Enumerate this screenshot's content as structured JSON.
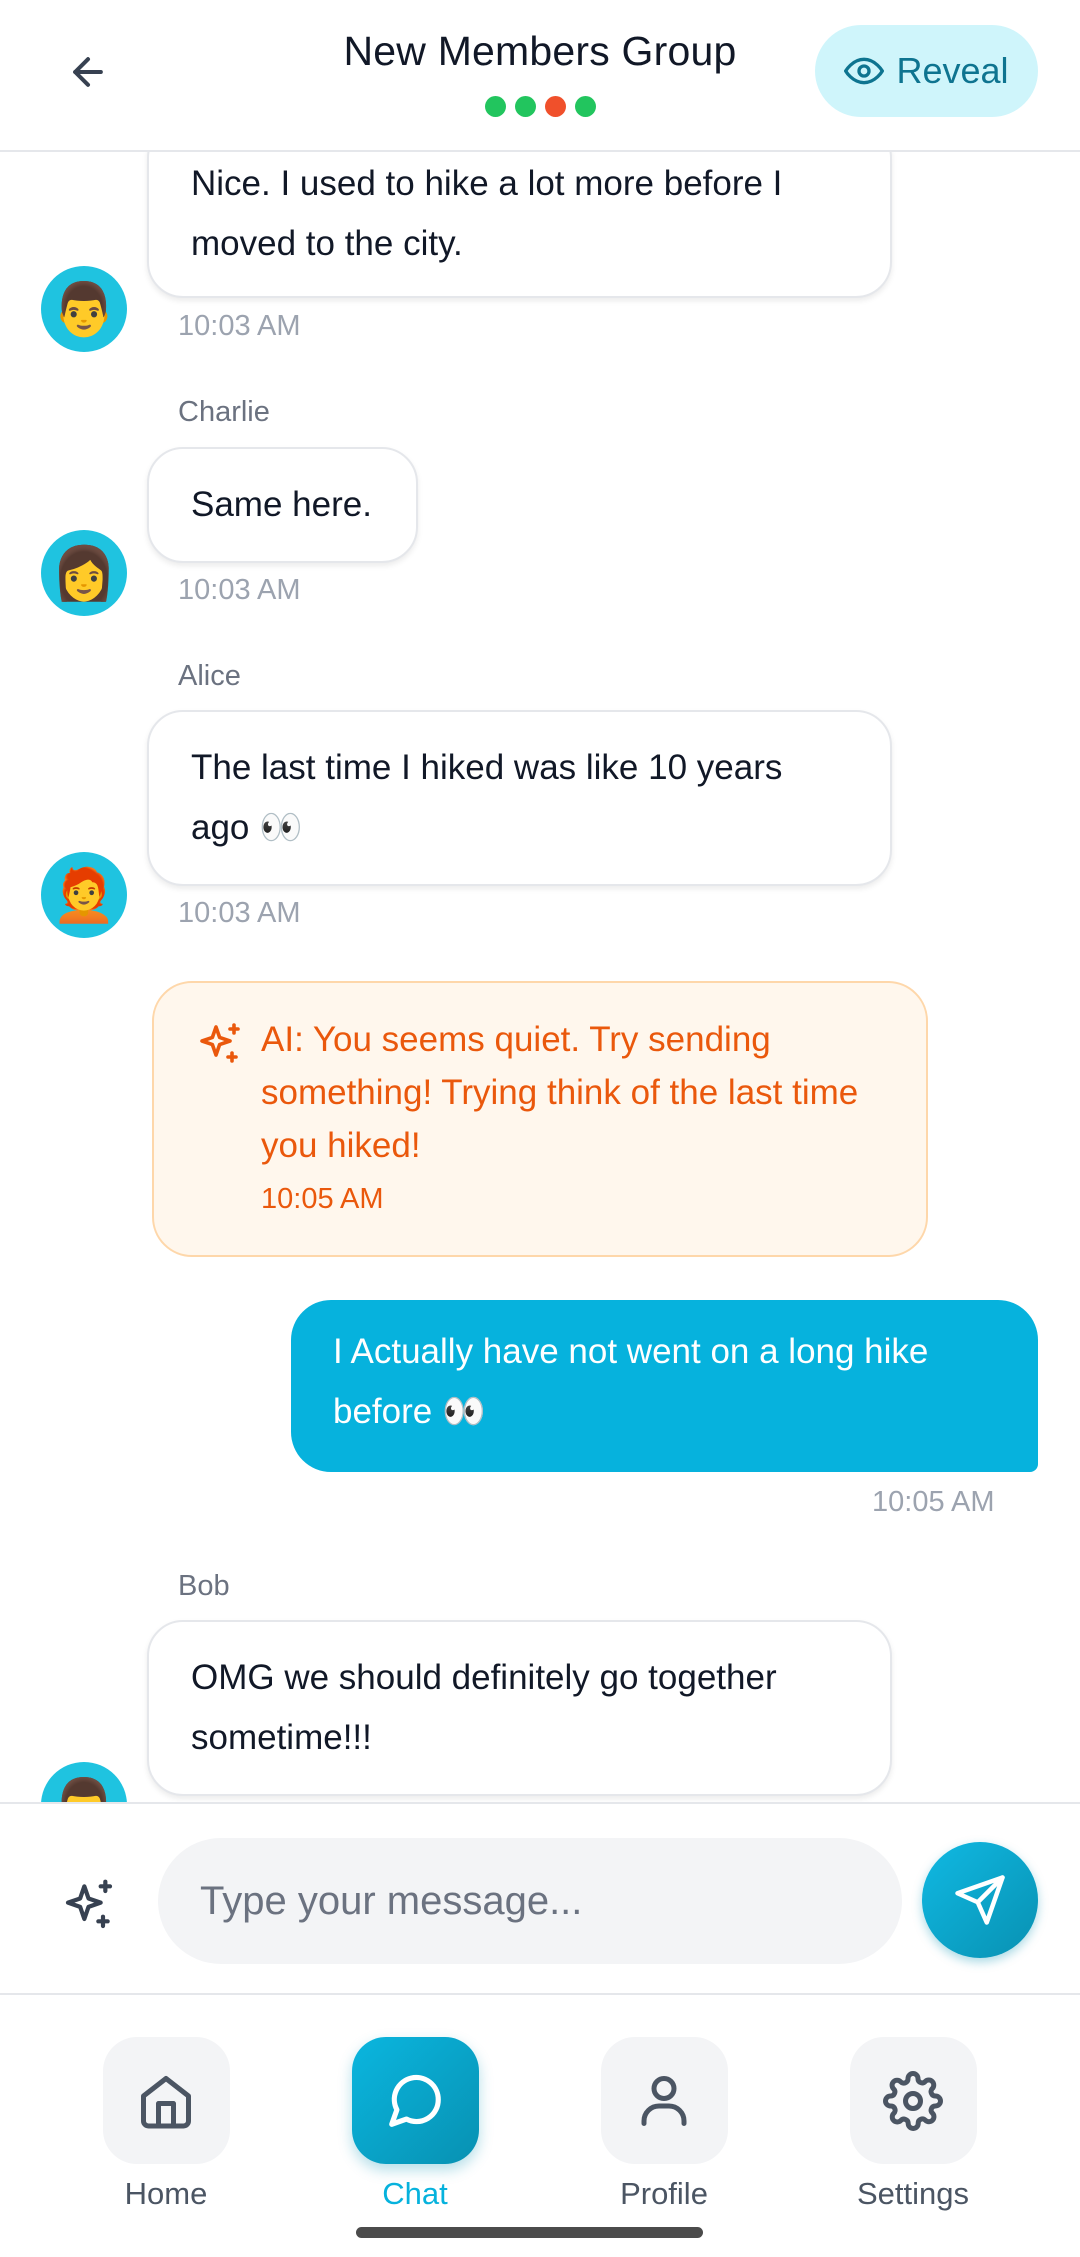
{
  "header": {
    "title": "New Members Group",
    "reveal_label": "Reveal",
    "status_dots": [
      "#22c55e",
      "#22c55e",
      "#f0502b",
      "#22c55e"
    ]
  },
  "messages": [
    {
      "sender": "",
      "text_lines": [
        "Nice. I used to hike a lot more before I",
        "moved to the city."
      ],
      "time": "10:03 AM",
      "avatar": "👨"
    },
    {
      "sender": "Charlie",
      "text_lines": [
        "Same here."
      ],
      "time": "10:03 AM",
      "avatar": "👩"
    },
    {
      "sender": "Alice",
      "text_lines": [
        "The last time I hiked was like 10 years",
        "ago 👀"
      ],
      "time": "10:03 AM",
      "avatar": "🧑‍🦰"
    },
    {
      "sender": "Bob",
      "text_lines": [
        "OMG we should definitely go together",
        "sometime!!!"
      ],
      "time": "",
      "avatar": "👨"
    }
  ],
  "ai_suggestion": {
    "text": "AI: You seems quiet. Try sending something! Trying think of the last time you hiked!",
    "time": "10:05 AM",
    "icon": "sparkles-icon"
  },
  "outgoing": {
    "text_lines": [
      "I Actually have not went on a long hike",
      "before 👀"
    ],
    "time": "10:05 AM"
  },
  "composer": {
    "placeholder": "Type your message...",
    "value": ""
  },
  "nav": {
    "items": [
      {
        "label": "Home",
        "icon": "home-icon",
        "active": false
      },
      {
        "label": "Chat",
        "icon": "chat-icon",
        "active": true
      },
      {
        "label": "Profile",
        "icon": "profile-icon",
        "active": false
      },
      {
        "label": "Settings",
        "icon": "settings-icon",
        "active": false
      }
    ]
  },
  "colors": {
    "accent": "#06b2dd",
    "ai_text": "#ea580c",
    "ai_bg": "#fff7ed",
    "avatar_bg": "#1fc3e0"
  }
}
